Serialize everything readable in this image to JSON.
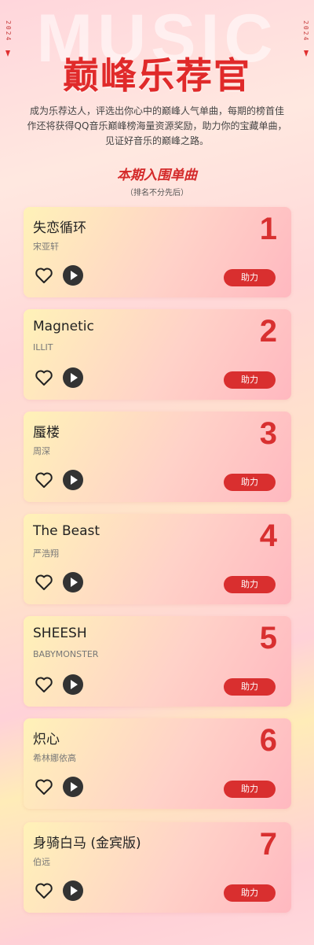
{
  "header": {
    "year": "2024",
    "watermark": "MUSIC",
    "title": "巅峰乐荐官",
    "intro": "成为乐荐达人，评选出你心中的巅峰人气单曲，每期的榜首佳作还将获得QQ音乐巅峰榜海量资源奖励，助力你的宝藏单曲，见证好音乐的巅峰之路。"
  },
  "section": {
    "title": "本期入围单曲",
    "subtitle": "（排名不分先后）"
  },
  "songs": [
    {
      "rank": "1",
      "title": "失恋循环",
      "artist": "宋亚轩",
      "button": "助力"
    },
    {
      "rank": "2",
      "title": "Magnetic",
      "artist": "ILLIT",
      "button": "助力"
    },
    {
      "rank": "3",
      "title": "蜃楼",
      "artist": "周深",
      "button": "助力"
    },
    {
      "rank": "4",
      "title": "The Beast",
      "artist": "严浩翔",
      "button": "助力"
    },
    {
      "rank": "5",
      "title": "SHEESH",
      "artist": "BABYMONSTER",
      "button": "助力"
    },
    {
      "rank": "6",
      "title": "炽心",
      "artist": "希林娜依高",
      "button": "助力"
    },
    {
      "rank": "7",
      "title": "身骑白马 (金宾版)",
      "artist": "伯远",
      "button": "助力"
    }
  ],
  "colors": {
    "accent": "#d92f2f",
    "title": "#e02a2a"
  }
}
